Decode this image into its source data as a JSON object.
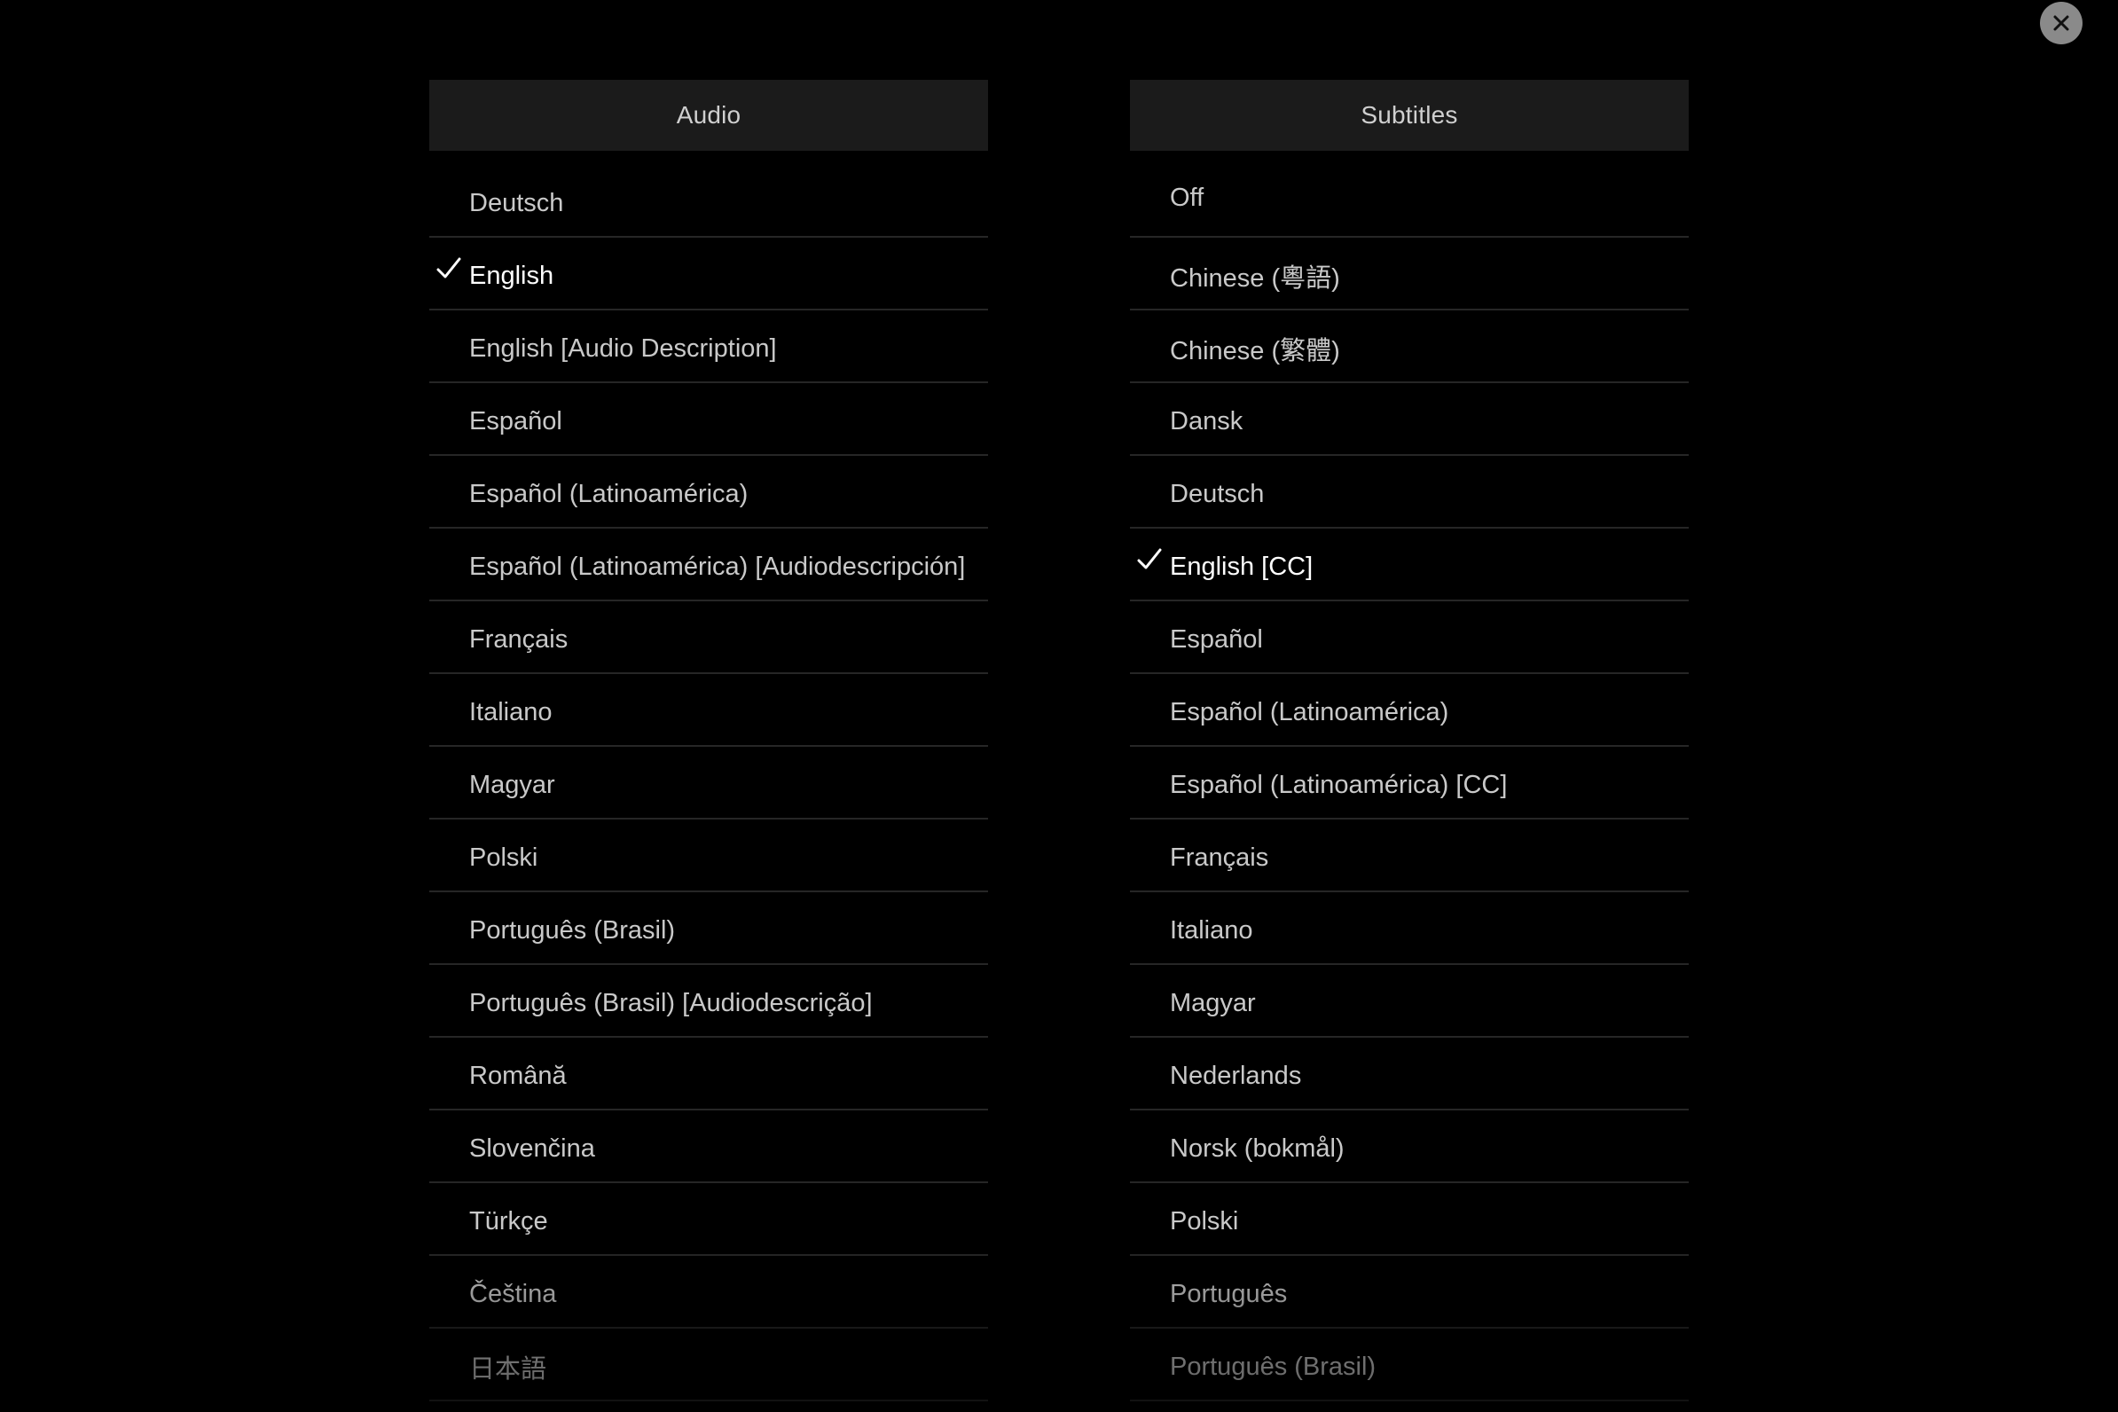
{
  "close_button": {
    "label": "Close",
    "icon": "close-icon",
    "color": "#8a8a8a"
  },
  "audio": {
    "header": "Audio",
    "selected_index": 1,
    "items": [
      {
        "label": "Deutsch",
        "selected": false
      },
      {
        "label": "English",
        "selected": true
      },
      {
        "label": "English [Audio Description]",
        "selected": false
      },
      {
        "label": "Español",
        "selected": false
      },
      {
        "label": "Español (Latinoamérica)",
        "selected": false
      },
      {
        "label": "Español (Latinoamérica) [Audiodescripción]",
        "selected": false
      },
      {
        "label": "Français",
        "selected": false
      },
      {
        "label": "Italiano",
        "selected": false
      },
      {
        "label": "Magyar",
        "selected": false
      },
      {
        "label": "Polski",
        "selected": false
      },
      {
        "label": "Português (Brasil)",
        "selected": false
      },
      {
        "label": "Português (Brasil) [Audiodescrição]",
        "selected": false
      },
      {
        "label": "Română",
        "selected": false
      },
      {
        "label": "Slovenčina",
        "selected": false
      },
      {
        "label": "Türkçe",
        "selected": false
      },
      {
        "label": "Čeština",
        "selected": false
      },
      {
        "label": "日本語",
        "selected": false
      }
    ]
  },
  "subtitles": {
    "header": "Subtitles",
    "selected_index": 5,
    "items": [
      {
        "label": "Off",
        "selected": false
      },
      {
        "label": "Chinese (粵語)",
        "selected": false
      },
      {
        "label": "Chinese (繁體)",
        "selected": false
      },
      {
        "label": "Dansk",
        "selected": false
      },
      {
        "label": "Deutsch",
        "selected": false
      },
      {
        "label": "English [CC]",
        "selected": true
      },
      {
        "label": "Español",
        "selected": false
      },
      {
        "label": "Español (Latinoamérica)",
        "selected": false
      },
      {
        "label": "Español (Latinoamérica) [CC]",
        "selected": false
      },
      {
        "label": "Français",
        "selected": false
      },
      {
        "label": "Italiano",
        "selected": false
      },
      {
        "label": "Magyar",
        "selected": false
      },
      {
        "label": "Nederlands",
        "selected": false
      },
      {
        "label": "Norsk (bokmål)",
        "selected": false
      },
      {
        "label": "Polski",
        "selected": false
      },
      {
        "label": "Português",
        "selected": false
      },
      {
        "label": "Português (Brasil)",
        "selected": false
      }
    ]
  },
  "colors": {
    "background": "#000000",
    "header_background": "#1b1b1b",
    "header_text": "#cfcfcf",
    "item_text": "#c9c9c9",
    "selected_text": "#ffffff",
    "separator": "#262626"
  }
}
